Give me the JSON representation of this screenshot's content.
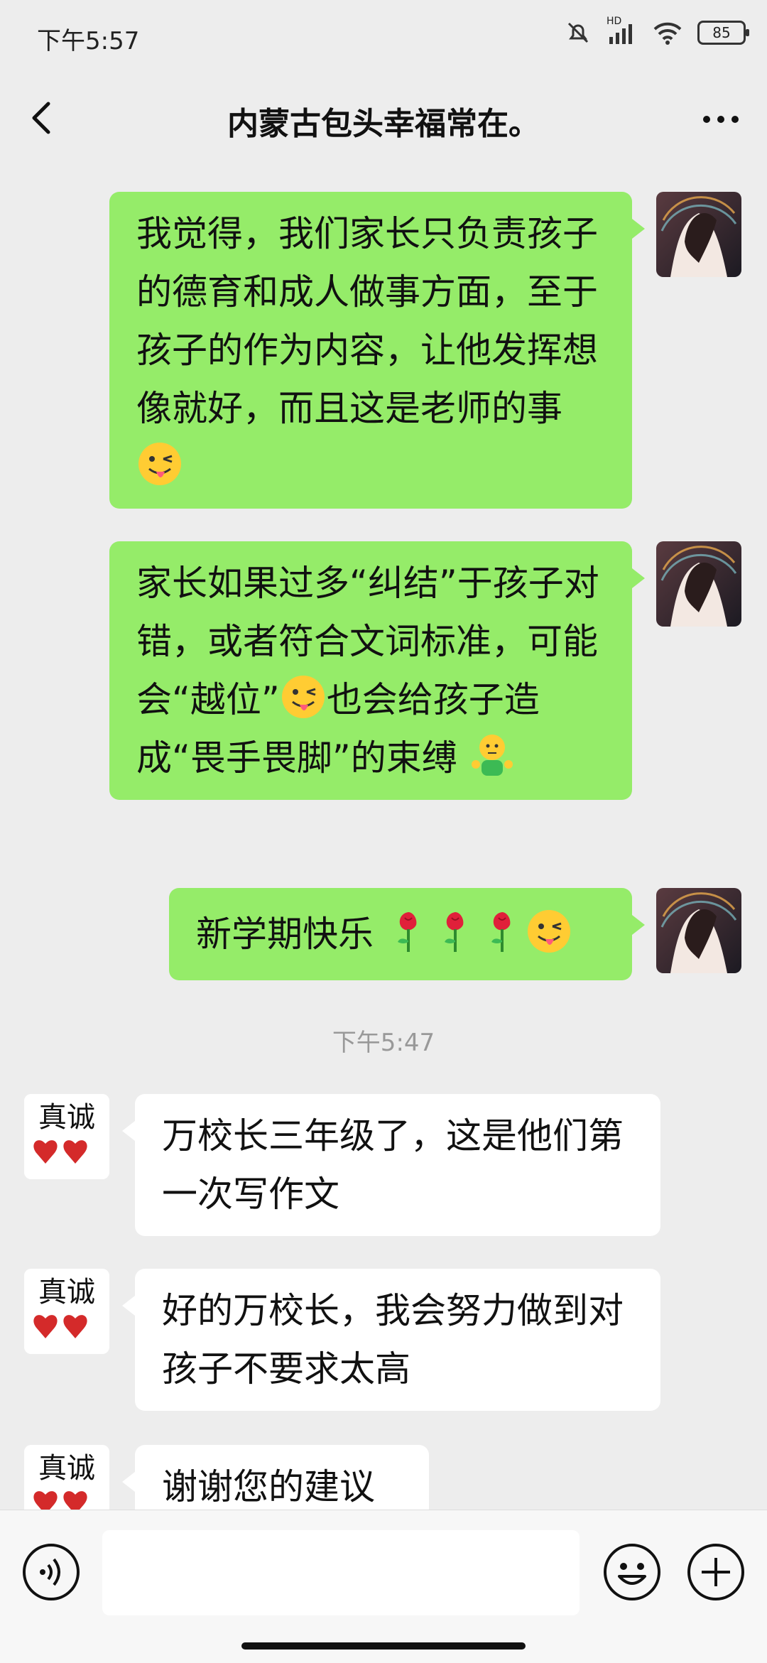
{
  "status": {
    "time": "下午5:57",
    "battery": "85",
    "network": "HD"
  },
  "header": {
    "title": "内蒙古包头幸福常在。"
  },
  "messages": [
    {
      "from": "me",
      "text": "我觉得，我们家长只负责孩子的德育和成人做事方面，至于孩子的作为内容，让他发挥想像就好，而且这是老师的事",
      "emoji": [
        "winking-tongue-emoji"
      ]
    },
    {
      "from": "me",
      "text_parts": [
        "家长如果过多“纠结”于孩子对错，或者符合文词标准，可能会“越位”",
        "也会给孩子造成“畏手畏脚”的束缚"
      ],
      "emoji": [
        "winking-tongue-emoji",
        "shrug-emoji"
      ]
    },
    {
      "from": "me",
      "text": "新学期快乐",
      "emoji": [
        "rose-emoji",
        "rose-emoji",
        "rose-emoji",
        "winking-tongue-emoji"
      ]
    },
    {
      "from": "other",
      "text": "万校长三年级了，这是他们第一次写作文"
    },
    {
      "from": "other",
      "text": "好的万校长，我会努力做到对孩子不要求太高"
    },
    {
      "from": "other",
      "text": "谢谢您的建议"
    }
  ],
  "timestamp": "下午5:47",
  "other_avatar": {
    "text": "真诚"
  },
  "input": {
    "value": ""
  },
  "colors": {
    "bg": "#ededed",
    "me_bubble": "#95ec69",
    "other_bubble": "#ffffff"
  }
}
